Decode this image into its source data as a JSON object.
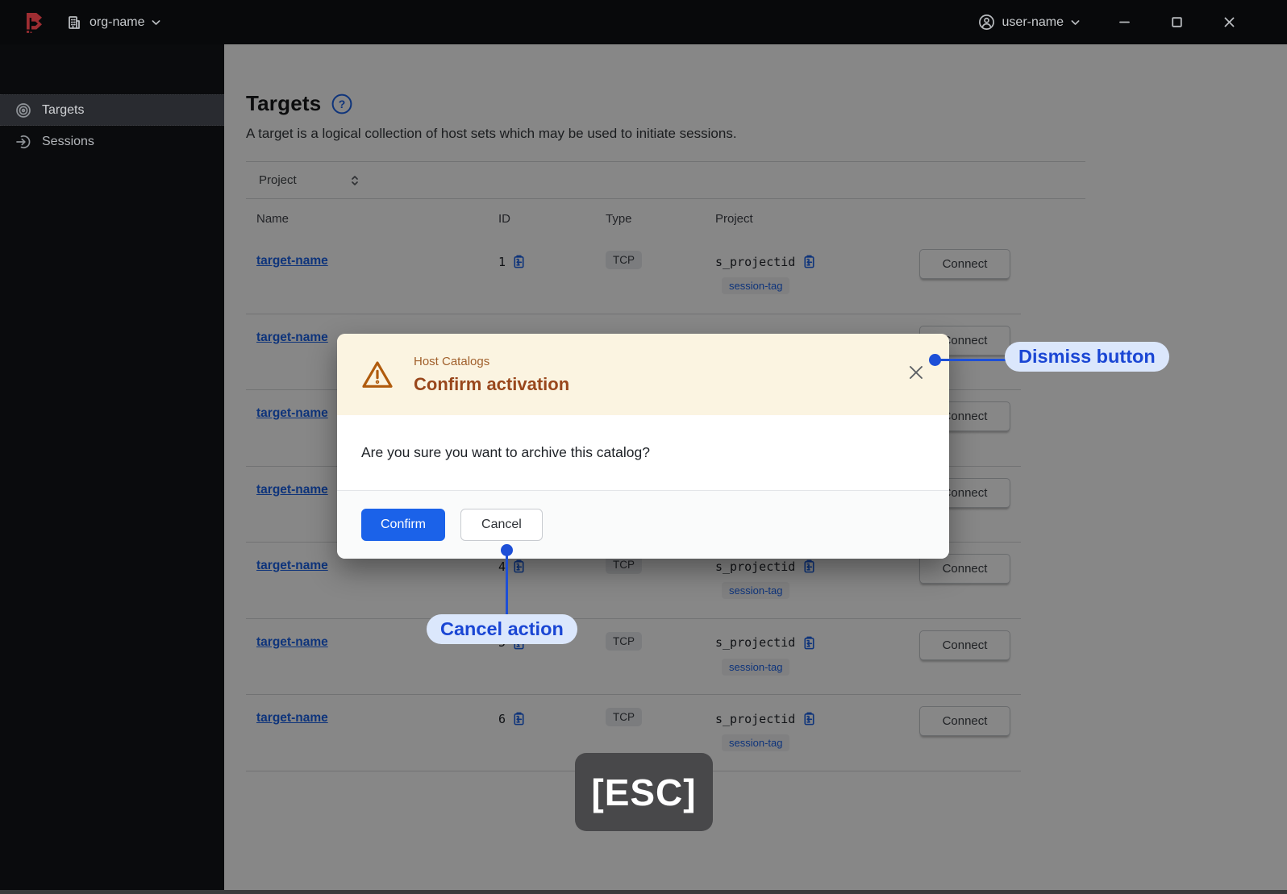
{
  "topbar": {
    "org_label": "org-name",
    "user_label": "user-name"
  },
  "sidebar": {
    "items": [
      {
        "label": "Targets",
        "icon": "target-icon",
        "active": true
      },
      {
        "label": "Sessions",
        "icon": "session-icon",
        "active": false
      }
    ]
  },
  "page": {
    "title": "Targets",
    "description": "A target is a logical collection of host sets which may be used to initiate sessions."
  },
  "filter": {
    "label": "Project"
  },
  "table": {
    "columns": [
      "Name",
      "ID",
      "Type",
      "Project"
    ],
    "connect_label": "Connect",
    "session_tag": "session-tag",
    "rows": [
      {
        "name": "target-name",
        "id": "1",
        "type": "TCP",
        "project": "s_projectid"
      },
      {
        "name": "target-name",
        "id": "",
        "type": "",
        "project": ""
      },
      {
        "name": "target-name",
        "id": "",
        "type": "",
        "project": ""
      },
      {
        "name": "target-name",
        "id": "",
        "type": "",
        "project": ""
      },
      {
        "name": "target-name",
        "id": "4",
        "type": "TCP",
        "project": "s_projectid"
      },
      {
        "name": "target-name",
        "id": "5",
        "type": "TCP",
        "project": "s_projectid"
      },
      {
        "name": "target-name",
        "id": "6",
        "type": "TCP",
        "project": "s_projectid"
      }
    ]
  },
  "modal": {
    "context": "Host Catalogs",
    "title": "Confirm activation",
    "message": "Are you sure you want to archive this catalog?",
    "confirm_label": "Confirm",
    "cancel_label": "Cancel"
  },
  "annotations": {
    "dismiss_label": "Dismiss button",
    "cancel_label": "Cancel action",
    "esc_label": "[ESC]"
  },
  "colors": {
    "accent_blue": "#1c62e8",
    "warning_surface": "#fbf4e1",
    "warning_title": "#99471c",
    "warning_context": "#a05f2b",
    "annotation_blue": "#1a46d4",
    "annotation_surface": "#dbe7fc",
    "esc_surface": "#48484a",
    "logo_red": "#9e2d32",
    "overlay": "rgba(0,0,0,0.47)"
  }
}
